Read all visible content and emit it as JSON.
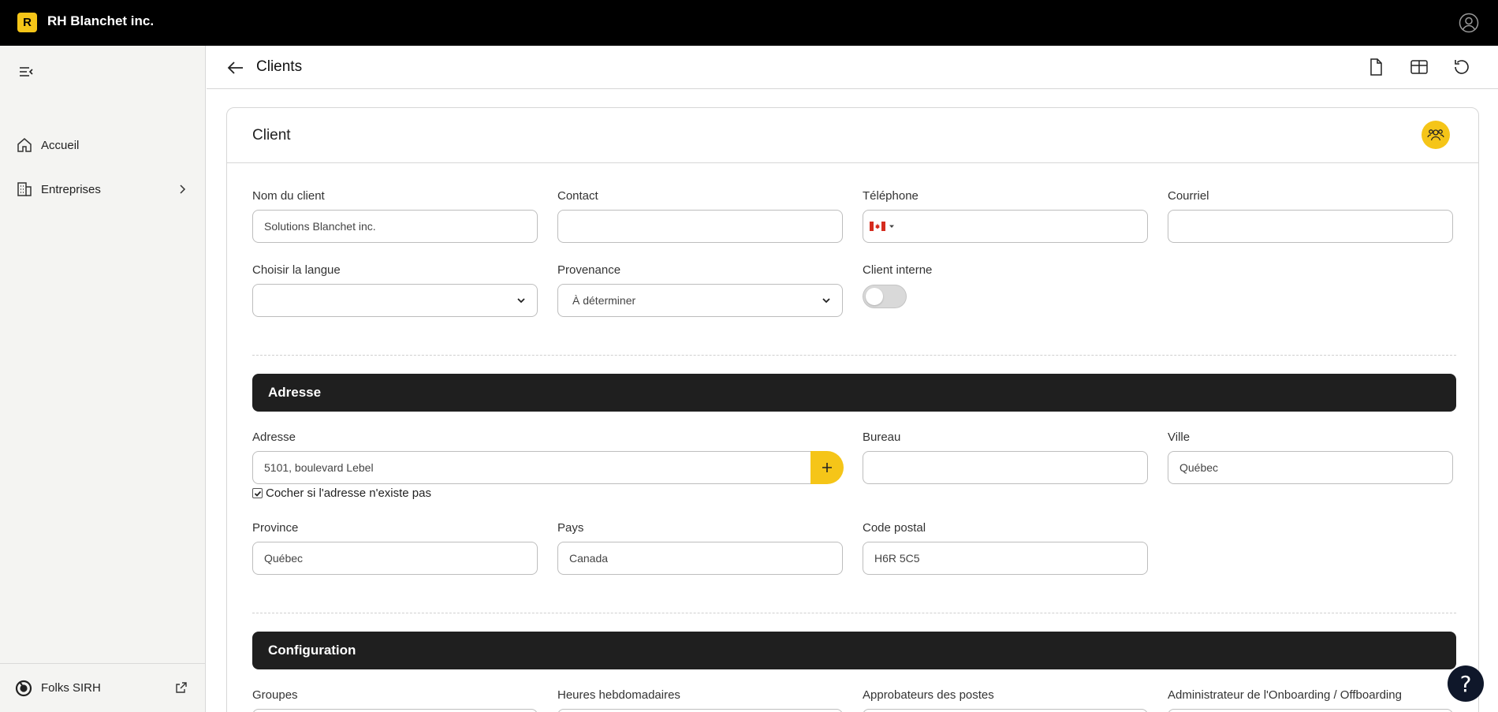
{
  "app": {
    "logo_letter": "R",
    "company_name": "RH Blanchet inc."
  },
  "sidebar": {
    "items": [
      {
        "label": "Accueil",
        "icon": "home-icon"
      },
      {
        "label": "Entreprises",
        "icon": "building-icon"
      }
    ],
    "footer": {
      "label": "Folks SIRH",
      "icon": "folks-logo-icon"
    }
  },
  "header": {
    "title": "Clients"
  },
  "card": {
    "title": "Client",
    "fields": {
      "client_name": {
        "label": "Nom du client",
        "value": "Solutions Blanchet inc."
      },
      "contact": {
        "label": "Contact",
        "value": ""
      },
      "phone": {
        "label": "Téléphone",
        "value": "",
        "flag": "CA"
      },
      "email": {
        "label": "Courriel",
        "value": ""
      },
      "language": {
        "label": "Choisir la langue",
        "value": ""
      },
      "source": {
        "label": "Provenance",
        "value": "À déterminer"
      },
      "internal": {
        "label": "Client interne",
        "checked": false
      }
    }
  },
  "address_section": {
    "title": "Adresse",
    "address": {
      "label": "Adresse",
      "value": "5101, boulevard Lebel"
    },
    "no_address_checkbox": {
      "label": "Cocher si l'adresse n'existe pas",
      "checked": true
    },
    "office": {
      "label": "Bureau",
      "value": ""
    },
    "city": {
      "label": "Ville",
      "value": "Québec"
    },
    "province": {
      "label": "Province",
      "value": "Québec"
    },
    "country": {
      "label": "Pays",
      "value": "Canada"
    },
    "postal_code": {
      "label": "Code postal",
      "value": "H6R 5C5"
    }
  },
  "config_section": {
    "title": "Configuration",
    "labels": {
      "groups": "Groupes",
      "weekly_hours": "Heures hebdomadaires",
      "approvers": "Approbateurs des postes",
      "onboarding_admin": "Administrateur de l'Onboarding / Offboarding"
    }
  },
  "help": {
    "label": "?"
  },
  "colors": {
    "accent": "#f5c518",
    "topbar": "#000000",
    "section_bar": "#1f1f1f",
    "help_button": "#0f172a"
  }
}
